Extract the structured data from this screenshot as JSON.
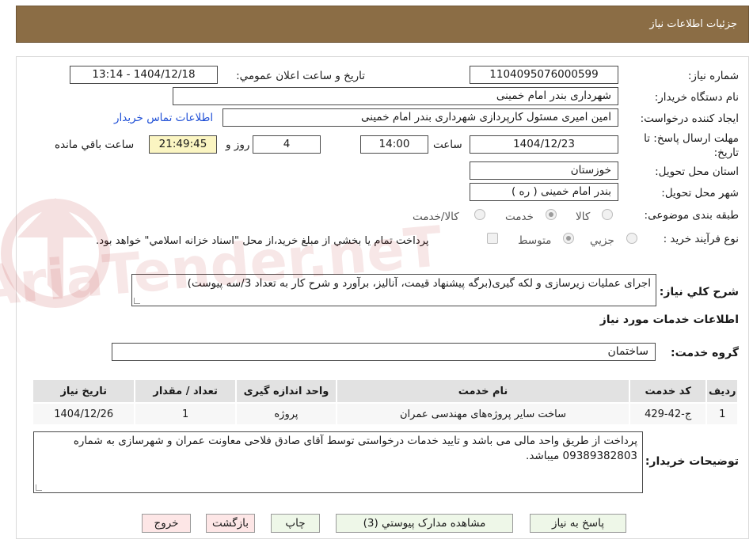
{
  "header": {
    "title": "جزئيات اطلاعات نياز"
  },
  "form": {
    "need_number_label": "شماره نياز:",
    "need_number": "1104095076000599",
    "announce_label": "تاريخ و ساعت اعلان عمومي:",
    "announce_value": "1404/12/18 - 13:14",
    "buyer_org_label": "نام دستگاه خريدار:",
    "buyer_org": "شهرداری بندر امام خمینی",
    "requester_label": "ايجاد کننده درخواست:",
    "requester": "امین امیری مسئول کارپردازی شهرداری بندر امام خمینی",
    "contact_link": "اطلاعات تماس خريدار",
    "deadline_label_1": "مهلت ارسال پاسخ: تا",
    "deadline_label_2": "تاريخ:",
    "deadline_date": "1404/12/23",
    "time_label": "ساعت",
    "deadline_time": "14:00",
    "days_value": "4",
    "days_label": "روز و",
    "remaining_time": "21:49:45",
    "remaining_label": "ساعت باقي مانده",
    "province_label": "استان محل تحويل:",
    "province": "خوزستان",
    "city_label": "شهر محل تحويل:",
    "city": "بندر امام خمینی ( ره )",
    "category_label": "طبقه بندی موضوعی:",
    "category_options": [
      "کالا",
      "خدمت",
      "کالا/خدمت"
    ],
    "process_label": "نوع فرآيند خريد :",
    "process_options": [
      "جزيي",
      "متوسط"
    ],
    "payment_note": "پرداخت تمام يا بخشي از مبلغ خريد،از محل \"اسناد خزانه اسلامي\" خواهد بود.",
    "description_label": "شرح کلي نياز:",
    "description": "اجرای عملیات زیرسازی و لکه گیری(برگه پیشنهاد قیمت، آنالیز، برآورد و شرح کار به تعداد 3/سه پیوست)",
    "services_heading": "اطلاعات خدمات مورد نياز",
    "service_group_label": "گروه خدمت:",
    "service_group": "ساختمان"
  },
  "table": {
    "headers": [
      "رديف",
      "کد خدمت",
      "نام خدمت",
      "واحد اندازه گيری",
      "تعداد / مقدار",
      "تاريخ نياز"
    ],
    "rows": [
      [
        "1",
        "ج-42-429",
        "ساخت سایر پروژه‌های مهندسی عمران",
        "پروژه",
        "1",
        "1404/12/26"
      ]
    ]
  },
  "buyer_notes": {
    "label": "توضيحات خريدار:",
    "text": "پرداخت از طریق واحد مالی می باشد و تایید خدمات درخواستی توسط آقای صادق فلاحی معاونت عمران و شهرسازی به شماره 09389382803 میباشد."
  },
  "buttons": {
    "reply": "پاسخ به نياز",
    "attachments": "مشاهده مدارک پيوستي (3)",
    "print": "چاپ",
    "back": "بازگشت",
    "exit": "خروج"
  },
  "watermark": {
    "text": "AriaTender.neT"
  },
  "colors": {
    "header_bg": "#8b6d45",
    "link": "#1f4fd6",
    "remaining_bg": "#fbf5c2",
    "button_green": "#eef7e8",
    "button_red": "#fde6e6"
  }
}
